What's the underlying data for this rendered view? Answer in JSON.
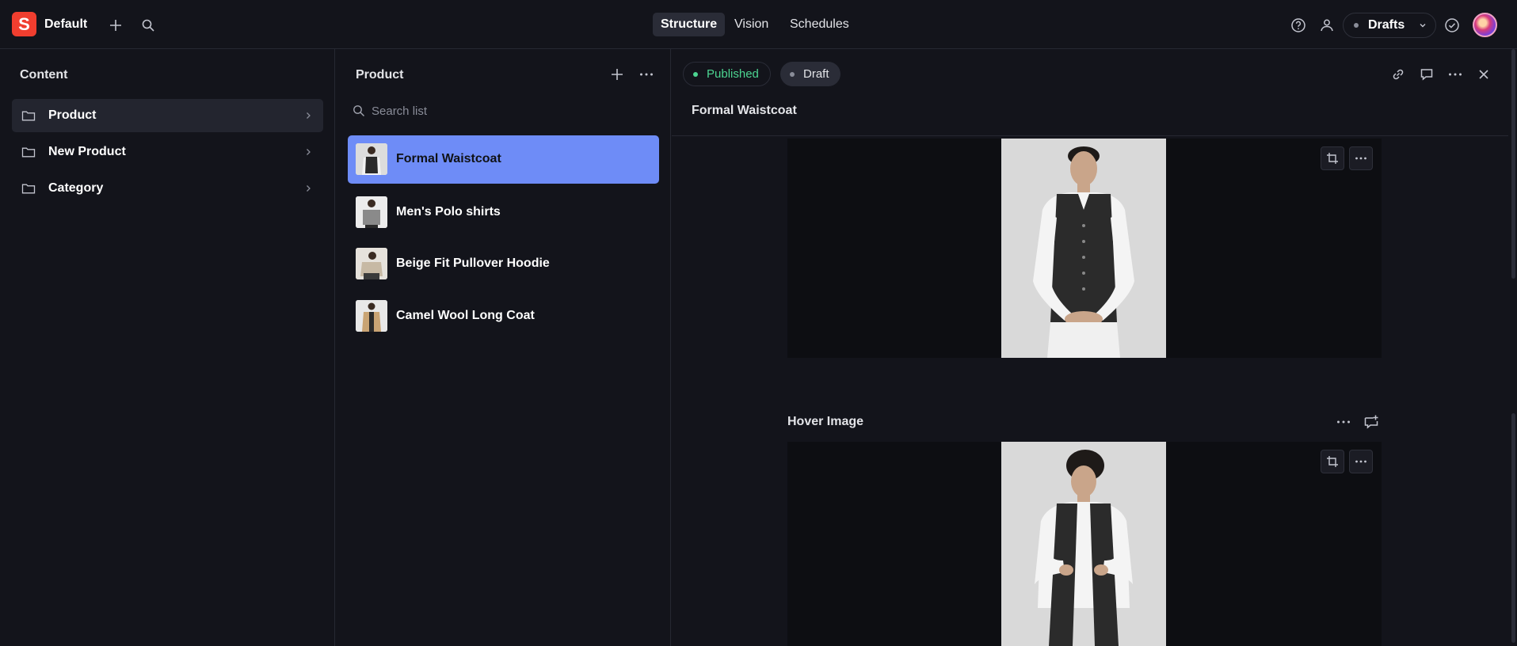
{
  "workspace": {
    "name": "Default",
    "logo_letter": "S"
  },
  "top_nav": [
    {
      "label": "Structure",
      "active": true
    },
    {
      "label": "Vision",
      "active": false
    },
    {
      "label": "Schedules",
      "active": false
    }
  ],
  "perspective": {
    "label": "Drafts"
  },
  "content_pane": {
    "title": "Content",
    "items": [
      {
        "label": "Product",
        "active": true
      },
      {
        "label": "New Product",
        "active": false
      },
      {
        "label": "Category",
        "active": false
      }
    ]
  },
  "product_pane": {
    "title": "Product",
    "search_placeholder": "Search list",
    "items": [
      {
        "label": "Formal Waistcoat",
        "active": true
      },
      {
        "label": "Men's Polo shirts",
        "active": false
      },
      {
        "label": "Beige Fit Pullover Hoodie",
        "active": false
      },
      {
        "label": "Camel Wool Long Coat",
        "active": false
      }
    ]
  },
  "document": {
    "status_published": "Published",
    "status_draft": "Draft",
    "title": "Formal Waistcoat",
    "hover_image_label": "Hover Image"
  },
  "colors": {
    "accent": "#6e8cf7",
    "brand": "#f03e2f",
    "published": "#4cd591"
  }
}
